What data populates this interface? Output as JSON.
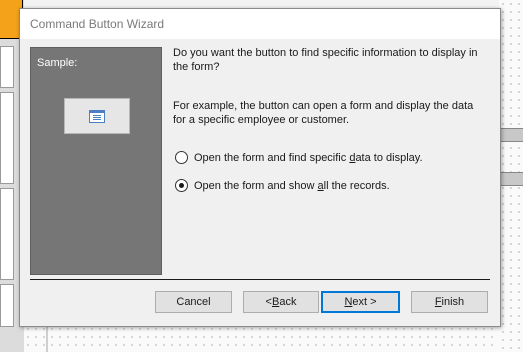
{
  "window": {
    "title": "Command Button Wizard"
  },
  "sample": {
    "label": "Sample:",
    "preview_icon": "form-icon"
  },
  "content": {
    "question": "Do you want the button to find specific information to display in the form?",
    "example": "For example, the button can open a form and display the data for a specific employee or customer."
  },
  "options": [
    {
      "pre": "Open the form and find specific ",
      "mnemonic": "d",
      "post": "ata to display.",
      "checked": false
    },
    {
      "pre": "Open the form and show ",
      "mnemonic": "a",
      "post": "ll the records.",
      "checked": true
    }
  ],
  "buttons": {
    "cancel": {
      "label": "Cancel"
    },
    "back": {
      "pre": "< ",
      "mnemonic": "B",
      "post": "ack"
    },
    "next": {
      "pre": "",
      "mnemonic": "N",
      "post": "ext >"
    },
    "finish": {
      "pre": "",
      "mnemonic": "F",
      "post": "inish"
    }
  },
  "colors": {
    "accent": "#0078d7",
    "background_highlight": "#f3a21a",
    "sample_panel": "#767676"
  }
}
